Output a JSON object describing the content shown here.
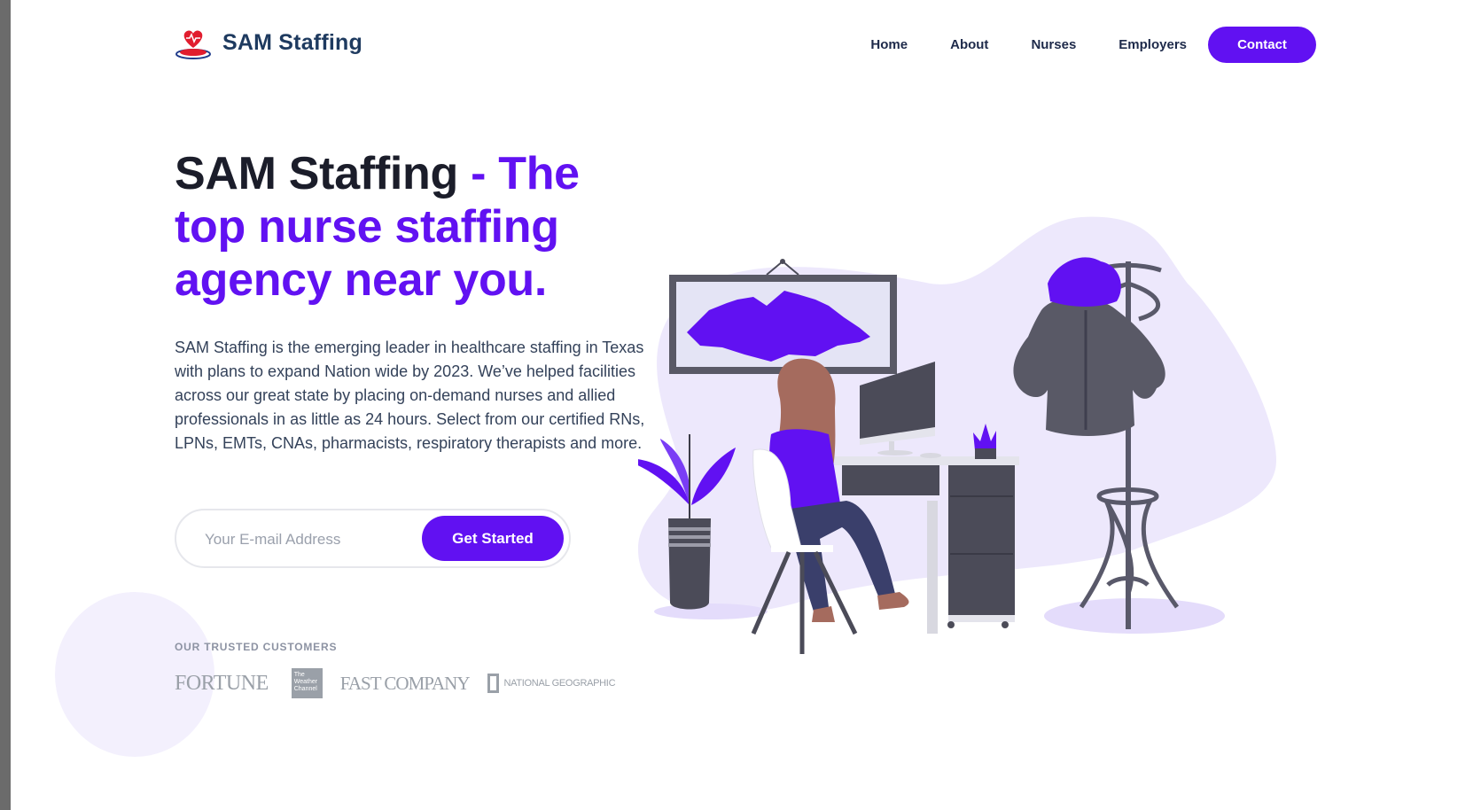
{
  "brand": {
    "name": "SAM Staffing",
    "logo_icon": "heart-hands-logo-icon"
  },
  "nav": {
    "items": [
      "Home",
      "About",
      "Nurses",
      "Employers"
    ],
    "contact": "Contact"
  },
  "hero": {
    "title_lead": "SAM Staffing",
    "title_accent": " - The top nurse staffing agency near you.",
    "description": "SAM Staffing is the emerging leader in healthcare staffing in Texas with plans to expand Nation wide by 2023. We’ve helped facilities across our great state by placing on-demand nurses and allied professionals in as little as 24 hours. Select from our certified RNs, LPNs, EMTs, CNAs, pharmacists, respiratory therapists and more.",
    "email_placeholder": "Your E-mail Address",
    "cta": "Get Started"
  },
  "customers": {
    "label": "OUR TRUSTED CUSTOMERS",
    "logos": [
      "FORTUNE",
      "The Weather Channel",
      "FAST COMPANY",
      "NATIONAL GEOGRAPHIC"
    ]
  },
  "colors": {
    "accent": "#6111f2",
    "heading": "#1b1d2a",
    "brand": "#1e3a5f",
    "blob": "#ede8fc",
    "muted": "#9aa0a8"
  }
}
